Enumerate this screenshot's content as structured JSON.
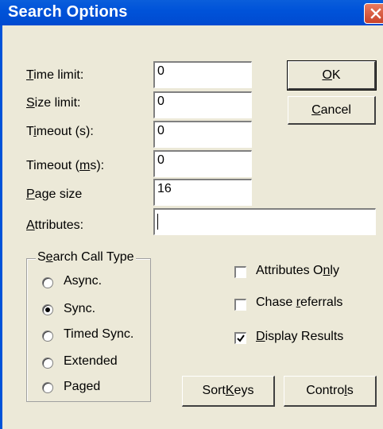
{
  "window": {
    "title": "Search Options",
    "close_icon": "close-x-icon",
    "accent": "#0053d9",
    "close_color": "#d9553a"
  },
  "fields": {
    "time_limit": {
      "label_pre": "",
      "label_key": "T",
      "label_post": "ime limit:",
      "value": "0"
    },
    "size_limit": {
      "label_pre": "",
      "label_key": "S",
      "label_post": "ize limit:",
      "value": "0"
    },
    "timeout_s": {
      "label_pre": "T",
      "label_key": "i",
      "label_post": "meout (s):",
      "value": "0"
    },
    "timeout_ms": {
      "label_pre": "Timeout (",
      "label_key": "m",
      "label_post": "s):",
      "value": "0"
    },
    "page_size": {
      "label_pre": "",
      "label_key": "P",
      "label_post": "age size",
      "value": "16"
    },
    "attributes": {
      "label_pre": "",
      "label_key": "A",
      "label_post": "ttributes:",
      "value": ""
    }
  },
  "buttons": {
    "ok": {
      "pre": "",
      "key": "O",
      "post": "K"
    },
    "cancel": {
      "pre": "",
      "key": "C",
      "post": "ancel"
    },
    "sort_keys": {
      "pre": "Sort ",
      "key": "K",
      "post": "eys"
    },
    "controls": {
      "pre": "Contro",
      "key": "l",
      "post": "s"
    }
  },
  "search_call_type": {
    "title_pre": "S",
    "title_key": "e",
    "title_post": "arch Call Type",
    "options": [
      "Async.",
      "Sync.",
      "Timed Sync.",
      "Extended",
      "Paged"
    ],
    "selected": "Sync."
  },
  "checkboxes": {
    "attributes_only": {
      "pre": "Attributes O",
      "key": "n",
      "post": "ly",
      "checked": false
    },
    "chase_referrals": {
      "pre": "Chase ",
      "key": "r",
      "post": "eferrals",
      "checked": false
    },
    "display_results": {
      "pre": "",
      "key": "D",
      "post": "isplay Results",
      "checked": true
    }
  }
}
